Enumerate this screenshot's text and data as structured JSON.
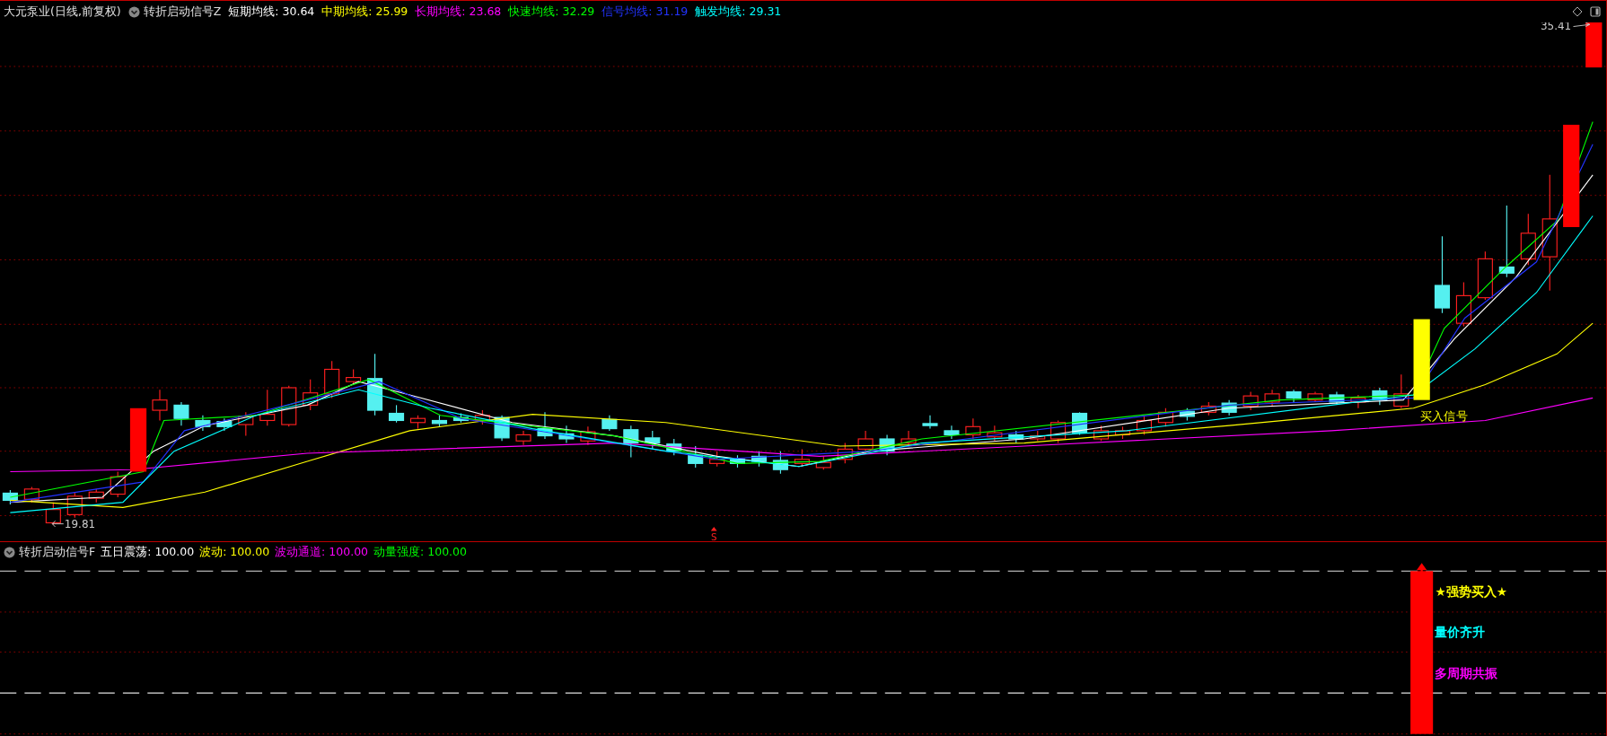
{
  "header": {
    "stock": "大元泵业(日线,前复权)",
    "indicator": "转折启动信号Z",
    "series": [
      {
        "label": "短期均线:",
        "value": "30.64",
        "color": "#ffffff"
      },
      {
        "label": "中期均线:",
        "value": "25.99",
        "color": "#ffff00"
      },
      {
        "label": "长期均线:",
        "value": "23.68",
        "color": "#ff00ff"
      },
      {
        "label": "快速均线:",
        "value": "32.29",
        "color": "#00ff00"
      },
      {
        "label": "信号均线:",
        "value": "31.19",
        "color": "#2233ff"
      },
      {
        "label": "触发均线:",
        "value": "29.31",
        "color": "#00ffff"
      }
    ]
  },
  "price_high": "35.41",
  "price_low": "19.81",
  "buy_label": "买入信号",
  "marker": "S",
  "lower": {
    "indicator": "转折启动信号F",
    "series": [
      {
        "label": "五日震荡:",
        "value": "100.00",
        "color": "#ffffff"
      },
      {
        "label": "波动:",
        "value": "100.00",
        "color": "#ffff00"
      },
      {
        "label": "波动通道:",
        "value": "100.00",
        "color": "#ff00ff"
      },
      {
        "label": "动量强度:",
        "value": "100.00",
        "color": "#00ff00"
      }
    ],
    "signals": [
      {
        "text": "★强势买入★",
        "color": "#ffff00"
      },
      {
        "text": "量价齐升",
        "color": "#00ffff"
      },
      {
        "text": "多周期共振",
        "color": "#ff00ff"
      }
    ]
  }
}
